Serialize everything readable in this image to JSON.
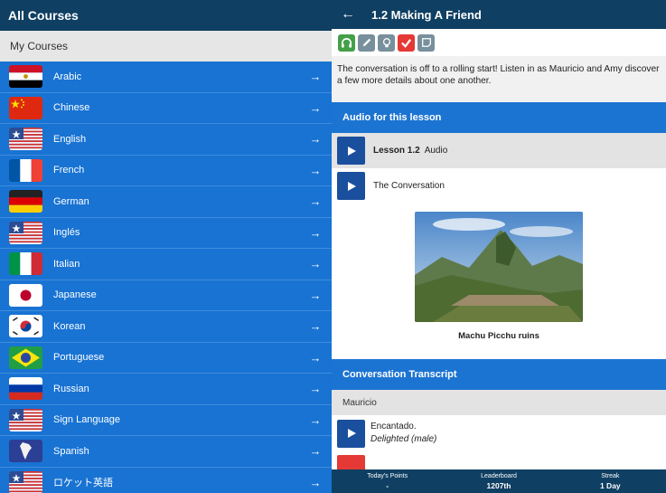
{
  "left_panel": {
    "title": "All Courses",
    "section_label": "My Courses",
    "courses": [
      {
        "label": "Arabic",
        "flag": "egypt-flag"
      },
      {
        "label": "Chinese",
        "flag": "china-flag"
      },
      {
        "label": "English",
        "flag": "usa-flag"
      },
      {
        "label": "French",
        "flag": "france-flag"
      },
      {
        "label": "German",
        "flag": "germany-flag"
      },
      {
        "label": "Inglés",
        "flag": "usa-flag"
      },
      {
        "label": "Italian",
        "flag": "italy-flag"
      },
      {
        "label": "Japanese",
        "flag": "japan-flag"
      },
      {
        "label": "Korean",
        "flag": "korea-flag"
      },
      {
        "label": "Portuguese",
        "flag": "brazil-flag"
      },
      {
        "label": "Russian",
        "flag": "russia-flag"
      },
      {
        "label": "Sign Language",
        "flag": "usa-flag"
      },
      {
        "label": "Spanish",
        "flag": "south-america-flag"
      },
      {
        "label": "ロケット英語",
        "flag": "usa-flag"
      }
    ],
    "arrow_glyph": "→"
  },
  "lesson": {
    "back_glyph": "←",
    "title": "1.2 Making A Friend",
    "toolbar_icons": [
      {
        "name": "headphones-icon",
        "color": "#43a047"
      },
      {
        "name": "pencil-icon",
        "color": "#78909c"
      },
      {
        "name": "lightbulb-icon",
        "color": "#78909c"
      },
      {
        "name": "checkmark-icon",
        "color": "#e53935"
      },
      {
        "name": "note-icon",
        "color": "#78909c"
      }
    ],
    "description": "The conversation is off to a rolling start! Listen in as Mauricio and Amy discover a few more details about one another.",
    "audio_section_title": "Audio for this lesson",
    "audio_items": [
      {
        "bold": "Lesson 1.2",
        "text": "Audio"
      },
      {
        "bold": "",
        "text": "The Conversation"
      }
    ],
    "photo_caption": "Machu Picchu ruins",
    "transcript_title": "Conversation Transcript",
    "speaker": "Mauricio",
    "lines": [
      {
        "text": "Encantado.",
        "translation": "Delighted (male)"
      }
    ]
  },
  "stats": {
    "points_label": "Today's Points",
    "points_value": "-",
    "leaderboard_label": "Leaderboard",
    "leaderboard_value": "1207th",
    "streak_label": "Streak",
    "streak_value": "1 Day"
  }
}
